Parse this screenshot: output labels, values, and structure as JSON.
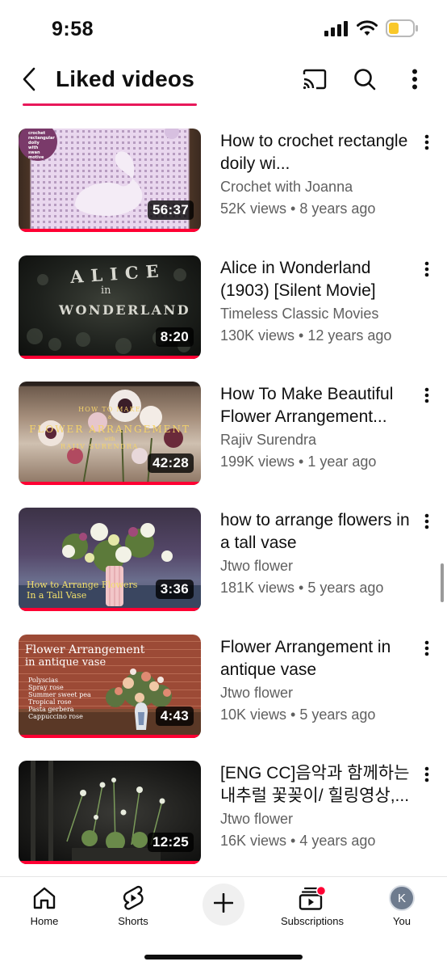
{
  "status_bar": {
    "time": "9:58",
    "battery_color": "#f9c82a"
  },
  "header": {
    "title": "Liked videos",
    "back_icon": "chevron-left-icon",
    "actions": [
      "cast-icon",
      "search-icon",
      "more-vertical-icon"
    ]
  },
  "videos": [
    {
      "title": "How to crochet rectangle doily wi...",
      "channel": "Crochet with Joanna",
      "meta": "52K views • 8 years ago",
      "duration": "56:37",
      "thumb_text": [
        "crochet",
        "rectangular",
        "doily",
        "with",
        "swan",
        "motive"
      ]
    },
    {
      "title": "Alice in Wonderland (1903) [Silent Movie]",
      "channel": "Timeless Classic Movies",
      "meta": "130K views • 12 years ago",
      "duration": "8:20",
      "thumb_text": [
        "ALICE",
        "in",
        "WONDERLAND"
      ]
    },
    {
      "title": "How To Make Beautiful Flower Arrangement...",
      "channel": "Rajiv Surendra",
      "meta": "199K views • 1 year ago",
      "duration": "42:28",
      "thumb_text": [
        "HOW TO MAKE",
        "a",
        "FLOWER ARRANGEMENT",
        "with",
        "RAJIV SURENDRA"
      ]
    },
    {
      "title": "how to arrange flowers in a tall vase",
      "channel": "Jtwo flower",
      "meta": "181K views • 5 years ago",
      "duration": "3:36",
      "thumb_text": [
        "How to Arrange Flowers",
        "In a Tall Vase"
      ]
    },
    {
      "title": "Flower Arrangement in antique vase",
      "channel": "Jtwo flower",
      "meta": "10K views • 5 years ago",
      "duration": "4:43",
      "thumb_text": [
        "Flower Arrangement",
        "in antique vase",
        "Polyscias",
        "Spray rose",
        "Summer sweet pea",
        "Tropical rose",
        "Pasta gerbera",
        "Cappuccino rose"
      ]
    },
    {
      "title": "[ENG CC]음악과 함께하는 내추럴 꽃꽂이/ 힐링영상,...",
      "channel": "Jtwo flower",
      "meta": "16K views • 4 years ago",
      "duration": "12:25",
      "thumb_text": []
    }
  ],
  "bottom_nav": {
    "items": [
      {
        "label": "Home",
        "icon": "home-icon"
      },
      {
        "label": "Shorts",
        "icon": "shorts-icon"
      },
      {
        "label": "",
        "icon": "plus-icon"
      },
      {
        "label": "Subscriptions",
        "icon": "subscriptions-icon"
      },
      {
        "label": "You",
        "icon": "avatar",
        "avatar_letter": "K"
      }
    ],
    "notification_color": "#ff0033"
  },
  "accent_color": "#e8185a"
}
